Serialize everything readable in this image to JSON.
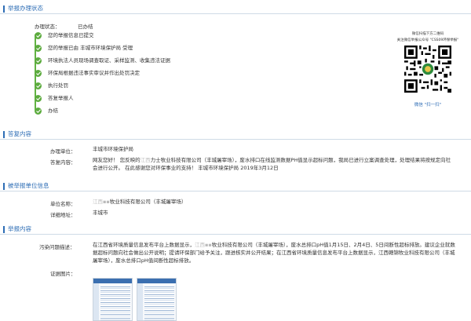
{
  "status_section": {
    "title": "举报办理状态",
    "status_label": "办理状态：",
    "status_value": "已办结",
    "steps": [
      "您的举报信息已提交",
      "您的举报已由 丰城市环境保护局 受理",
      "环境执法人员现场调查取证、采样监测、收集违法证据",
      "环保局根据违法事实审议并作出处罚决定",
      "执行处罚",
      "答复举报人",
      "办结"
    ]
  },
  "qr": {
    "caption_line1": "微信扫描下方二维码",
    "caption_line2": "关注微信举报公众号 \"CSS09环保举报\"",
    "scan_text": "微信 \"扫一扫\""
  },
  "reply_section": {
    "title": "答复内容",
    "unit_label": "办理单位：",
    "unit_value": "丰城市环境保护局",
    "content_label": "答复内容：",
    "content_p1": "网友您好！ 您反映的",
    "content_p2": "江西",
    "content_p3": "力士牧业科技有限公司（丰城屠宰场），废水排口在线监测数据PH值显示超标问题，我局已进行立案调查处理，处理结果将按规定向社会进行公开。 在此感谢您对环保事业的支持！ 丰城市环境保护局 2019年3月12日"
  },
  "unit_section": {
    "title": "被举报单位信息",
    "name_label": "单位名称：",
    "name_p1": "江西",
    "name_p2": "牧业科技有限公司（丰城屠宰场）",
    "address_label": "详细地址：",
    "address_value": "丰城市"
  },
  "report_section": {
    "title": "举报内容",
    "desc_label": "污染问题描述：",
    "desc_p1": "在江西省环境质量信息发布平台上数据显示，",
    "desc_p2": "江西",
    "desc_p3": "牧业科技有限公司（丰城屠宰场），废水总排口pH值1月15日、2月4日、5日间断性超标排放。建议企业就数据超标问题向社会做出公开说明；提请环保部门给予关注，跟进核实并公开结果；在江西省环境质量信息发布平台上数据显示，江西赣锦牧业科技有限公司（丰城屠宰场），废水总排口pH值间断性超标排放。",
    "evidence_label": "证据图片："
  },
  "colors": {
    "accent": "#2d6db5",
    "step_green": "#5cab3e"
  }
}
